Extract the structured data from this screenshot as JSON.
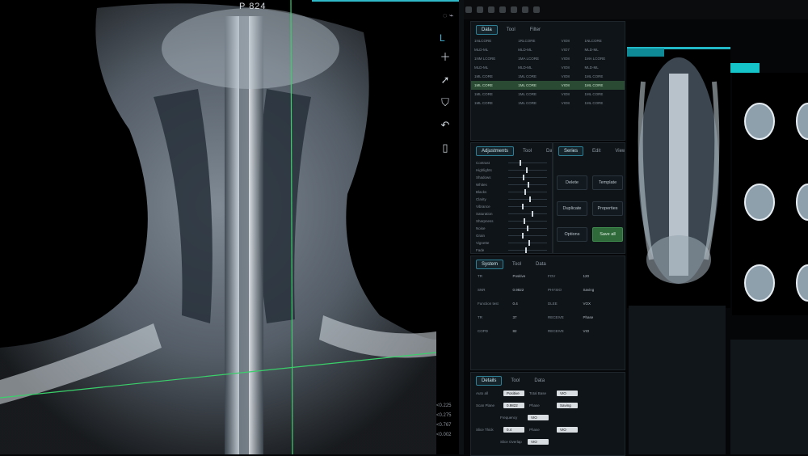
{
  "viewer": {
    "slice_label": "P 824",
    "orientation_label": "L",
    "tools": [
      "plus-icon",
      "cursor-icon",
      "rotate-icon",
      "undo-icon",
      "trash-icon"
    ],
    "coords": [
      "<0.225",
      "<0.275",
      "<0.767",
      "<0.002"
    ]
  },
  "series_panel": {
    "tabs": [
      "Data",
      "Tool",
      "Filter"
    ],
    "rows": [
      [
        "1NLCORE",
        "1RLCORE",
        "VIO8",
        "1NLCORE"
      ],
      [
        "MLD-ML",
        "MLD-ML",
        "VIO7",
        "MLD-ML"
      ],
      [
        "1NM LCORE",
        "1MA LCORE",
        "VIO8",
        "1MA LCORE"
      ],
      [
        "MLD-ML",
        "MLD-ML",
        "VIO8",
        "MLD-ML"
      ],
      [
        "1ML CORE",
        "1ML CORE",
        "VIO8",
        "1ML CORE"
      ],
      [
        "1ML CORE",
        "1ML CORE",
        "VIO8",
        "1ML CORE"
      ],
      [
        "1ML CORE",
        "1ML CORE",
        "VIO8",
        "1ML CORE"
      ],
      [
        "1ML CORE",
        "1ML CORE",
        "VIO8",
        "1ML CORE"
      ]
    ],
    "selected_row": 5
  },
  "adjust_panel": {
    "tabs": [
      "Adjustments",
      "Tool",
      "Data"
    ],
    "slider_labels": [
      "Contrast",
      "Highlights",
      "Shadows",
      "Whites",
      "Blacks",
      "Clarity",
      "Vibrance",
      "Saturation",
      "Sharpness",
      "Noise",
      "Grain",
      "Vignette",
      "Fade"
    ],
    "slider_levels": [
      0.3,
      0.45,
      0.38,
      0.5,
      0.42,
      0.55,
      0.35,
      0.6,
      0.4,
      0.48,
      0.36,
      0.52,
      0.44
    ]
  },
  "action_panel": {
    "tabs": [
      "Series",
      "Edit",
      "View"
    ],
    "buttons": [
      "Delete",
      "Template",
      "Duplicate",
      "Properties",
      "Options",
      "Save all"
    ]
  },
  "system_panel": {
    "tabs": [
      "System",
      "Tool",
      "Data"
    ],
    "rows": [
      [
        "TR",
        "Positive",
        "FOV",
        "120"
      ],
      [
        "SNR",
        "0.9822",
        "PHYSIO",
        "Saving"
      ],
      [
        "Function test",
        "0.4",
        "DLEE",
        "VOX"
      ],
      [
        "TR",
        "37",
        "RECEIVE",
        "Phase"
      ],
      [
        "COPD",
        "82",
        "RECEIVE",
        "VIO"
      ]
    ]
  },
  "details_panel": {
    "tabs": [
      "Details",
      "Tool",
      "Data"
    ],
    "rows": [
      [
        "Auto all",
        "Positive",
        "Total Base",
        "VIO"
      ],
      [
        "Scan Plane",
        "0.9822",
        "Phase",
        "Saving"
      ],
      [
        "",
        "",
        "Frequency",
        "VIO"
      ],
      [
        "Slice Thick",
        "0.4",
        "Phase",
        "VIO"
      ],
      [
        "",
        "",
        "Slice Overlap",
        "VIO"
      ]
    ]
  },
  "colors": {
    "accent": "#22b8c8",
    "selected_green": "#2f6a3b"
  }
}
